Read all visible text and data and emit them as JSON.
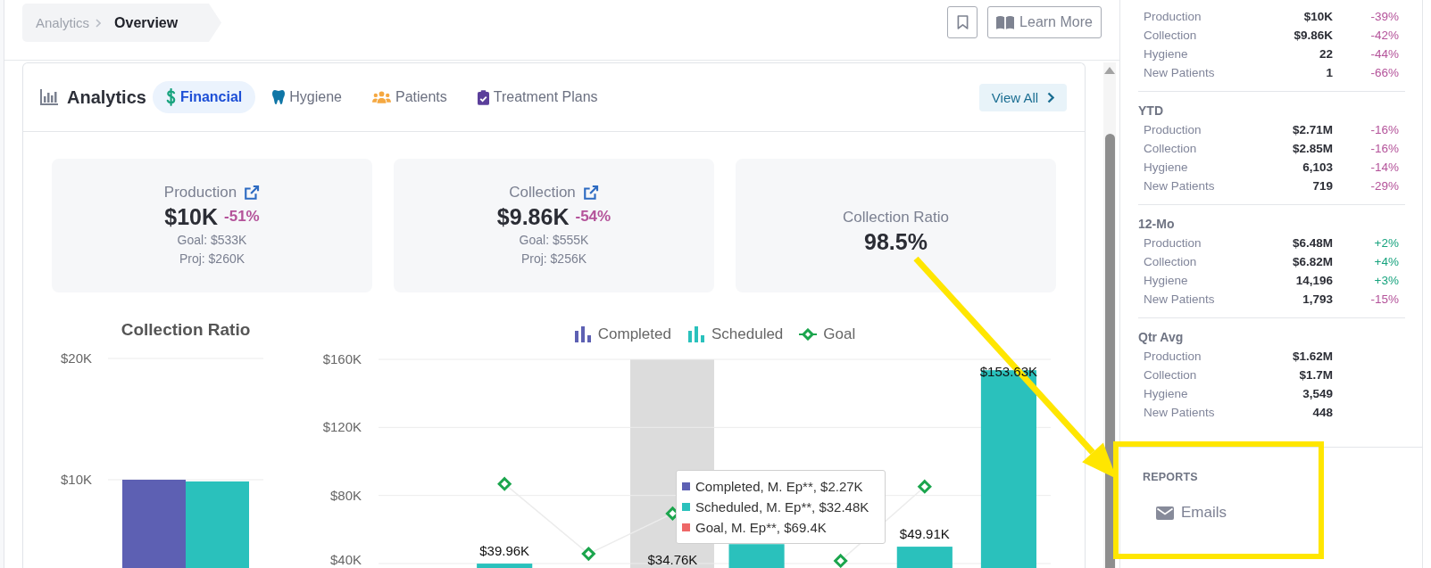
{
  "breadcrumb": [
    {
      "label": "Analytics",
      "current": false
    },
    {
      "label": "Overview",
      "current": true
    }
  ],
  "learn_more": {
    "label": "Learn More"
  },
  "analytics": {
    "title": "Analytics",
    "tabs": [
      {
        "label": "Financial",
        "selected": true
      },
      {
        "label": "Hygiene",
        "selected": false
      },
      {
        "label": "Patients",
        "selected": false
      },
      {
        "label": "Treatment Plans",
        "selected": false
      }
    ],
    "view_all": "View All"
  },
  "stat_cards": [
    {
      "label": "Production",
      "linked": true,
      "value": "$10K",
      "change": "-51%",
      "negative": true,
      "goal": "Goal: $533K",
      "projection": "Proj: $260K"
    },
    {
      "label": "Collection",
      "linked": true,
      "value": "$9.86K",
      "change": "-54%",
      "negative": true,
      "goal": "Goal: $555K",
      "projection": "Proj: $256K"
    },
    {
      "label": "Collection Ratio",
      "linked": false,
      "value": "98.5%"
    }
  ],
  "collection_ratio_chart": {
    "chart_data": {
      "type": "bar",
      "title": "Collection Ratio",
      "grid": true,
      "ylim": [
        2.72,
        20
      ],
      "series": [
        {
          "color": "#5d60b3",
          "values": [
            10
          ]
        },
        {
          "color": "#2ac1bc",
          "values": [
            9.86
          ]
        }
      ],
      "yticks": [
        {
          "value": 10,
          "label": "$10K"
        },
        {
          "value": 20,
          "label": "$20K"
        }
      ]
    }
  },
  "production_chart": {
    "chart_data": {
      "type": "bar",
      "grid": true,
      "legend": "top",
      "ylim": [
        37.38,
        160
      ],
      "series": [
        {
          "name": "Completed",
          "type": "bar",
          "color": "#5d60b3",
          "values": [
            null,
            null,
            null,
            null,
            null,
            null,
            null,
            null
          ]
        },
        {
          "name": "Scheduled",
          "type": "bar",
          "color": "#2ac1bc",
          "values": [
            null,
            39.96,
            null,
            null,
            51.4,
            null,
            49.91,
            153.63
          ]
        },
        {
          "name": "Goal",
          "type": "line",
          "marker": "diamond",
          "color": "#1ba54d",
          "values": [
            null,
            86.8,
            45.7,
            69.4,
            null,
            41.6,
            85.2,
            null
          ]
        }
      ],
      "yticks": [
        {
          "value": 40,
          "label": "$40K"
        },
        {
          "value": 80,
          "label": "$80K"
        },
        {
          "value": 120,
          "label": "$120K"
        },
        {
          "value": 160,
          "label": "$160K"
        }
      ],
      "value_labels": [
        null,
        "$39.96K",
        null,
        "$34.76K",
        null,
        null,
        "$49.91K",
        "$153.63K"
      ]
    },
    "tooltip": {
      "rows": [
        {
          "text": "Completed, M. Ep**, $2.27K",
          "color": "#5d60b3"
        },
        {
          "text": "Scheduled, M. Ep**, $32.48K",
          "color": "#2ac1bc"
        },
        {
          "text": "Goal, M. Ep**, $69.4K",
          "color": "#ee6868"
        }
      ]
    }
  },
  "summary": {
    "sections": [
      {
        "rows": [
          {
            "label": "Production",
            "value": "$10K",
            "change": "-39%",
            "negative": true
          },
          {
            "label": "Collection",
            "value": "$9.86K",
            "change": "-42%",
            "negative": true
          },
          {
            "label": "Hygiene",
            "value": "22",
            "change": "-44%",
            "negative": true
          },
          {
            "label": "New Patients",
            "value": "1",
            "change": "-66%",
            "negative": true
          }
        ]
      },
      {
        "title": "YTD",
        "rows": [
          {
            "label": "Production",
            "value": "$2.71M",
            "change": "-16%",
            "negative": true
          },
          {
            "label": "Collection",
            "value": "$2.85M",
            "change": "-16%",
            "negative": true
          },
          {
            "label": "Hygiene",
            "value": "6,103",
            "change": "-14%",
            "negative": true
          },
          {
            "label": "New Patients",
            "value": "719",
            "change": "-29%",
            "negative": true
          }
        ]
      },
      {
        "title": "12-Mo",
        "rows": [
          {
            "label": "Production",
            "value": "$6.48M",
            "change": "+2%",
            "negative": false
          },
          {
            "label": "Collection",
            "value": "$6.82M",
            "change": "+4%",
            "negative": false
          },
          {
            "label": "Hygiene",
            "value": "14,196",
            "change": "+3%",
            "negative": false
          },
          {
            "label": "New Patients",
            "value": "1,793",
            "change": "-15%",
            "negative": true
          }
        ]
      },
      {
        "title": "Qtr Avg",
        "rows": [
          {
            "label": "Production",
            "value": "$1.62M"
          },
          {
            "label": "Collection",
            "value": "$1.7M"
          },
          {
            "label": "Hygiene",
            "value": "3,549"
          },
          {
            "label": "New Patients",
            "value": "448"
          }
        ]
      }
    ]
  },
  "reports": {
    "heading": "REPORTS",
    "items": [
      {
        "label": "Emails"
      }
    ]
  }
}
